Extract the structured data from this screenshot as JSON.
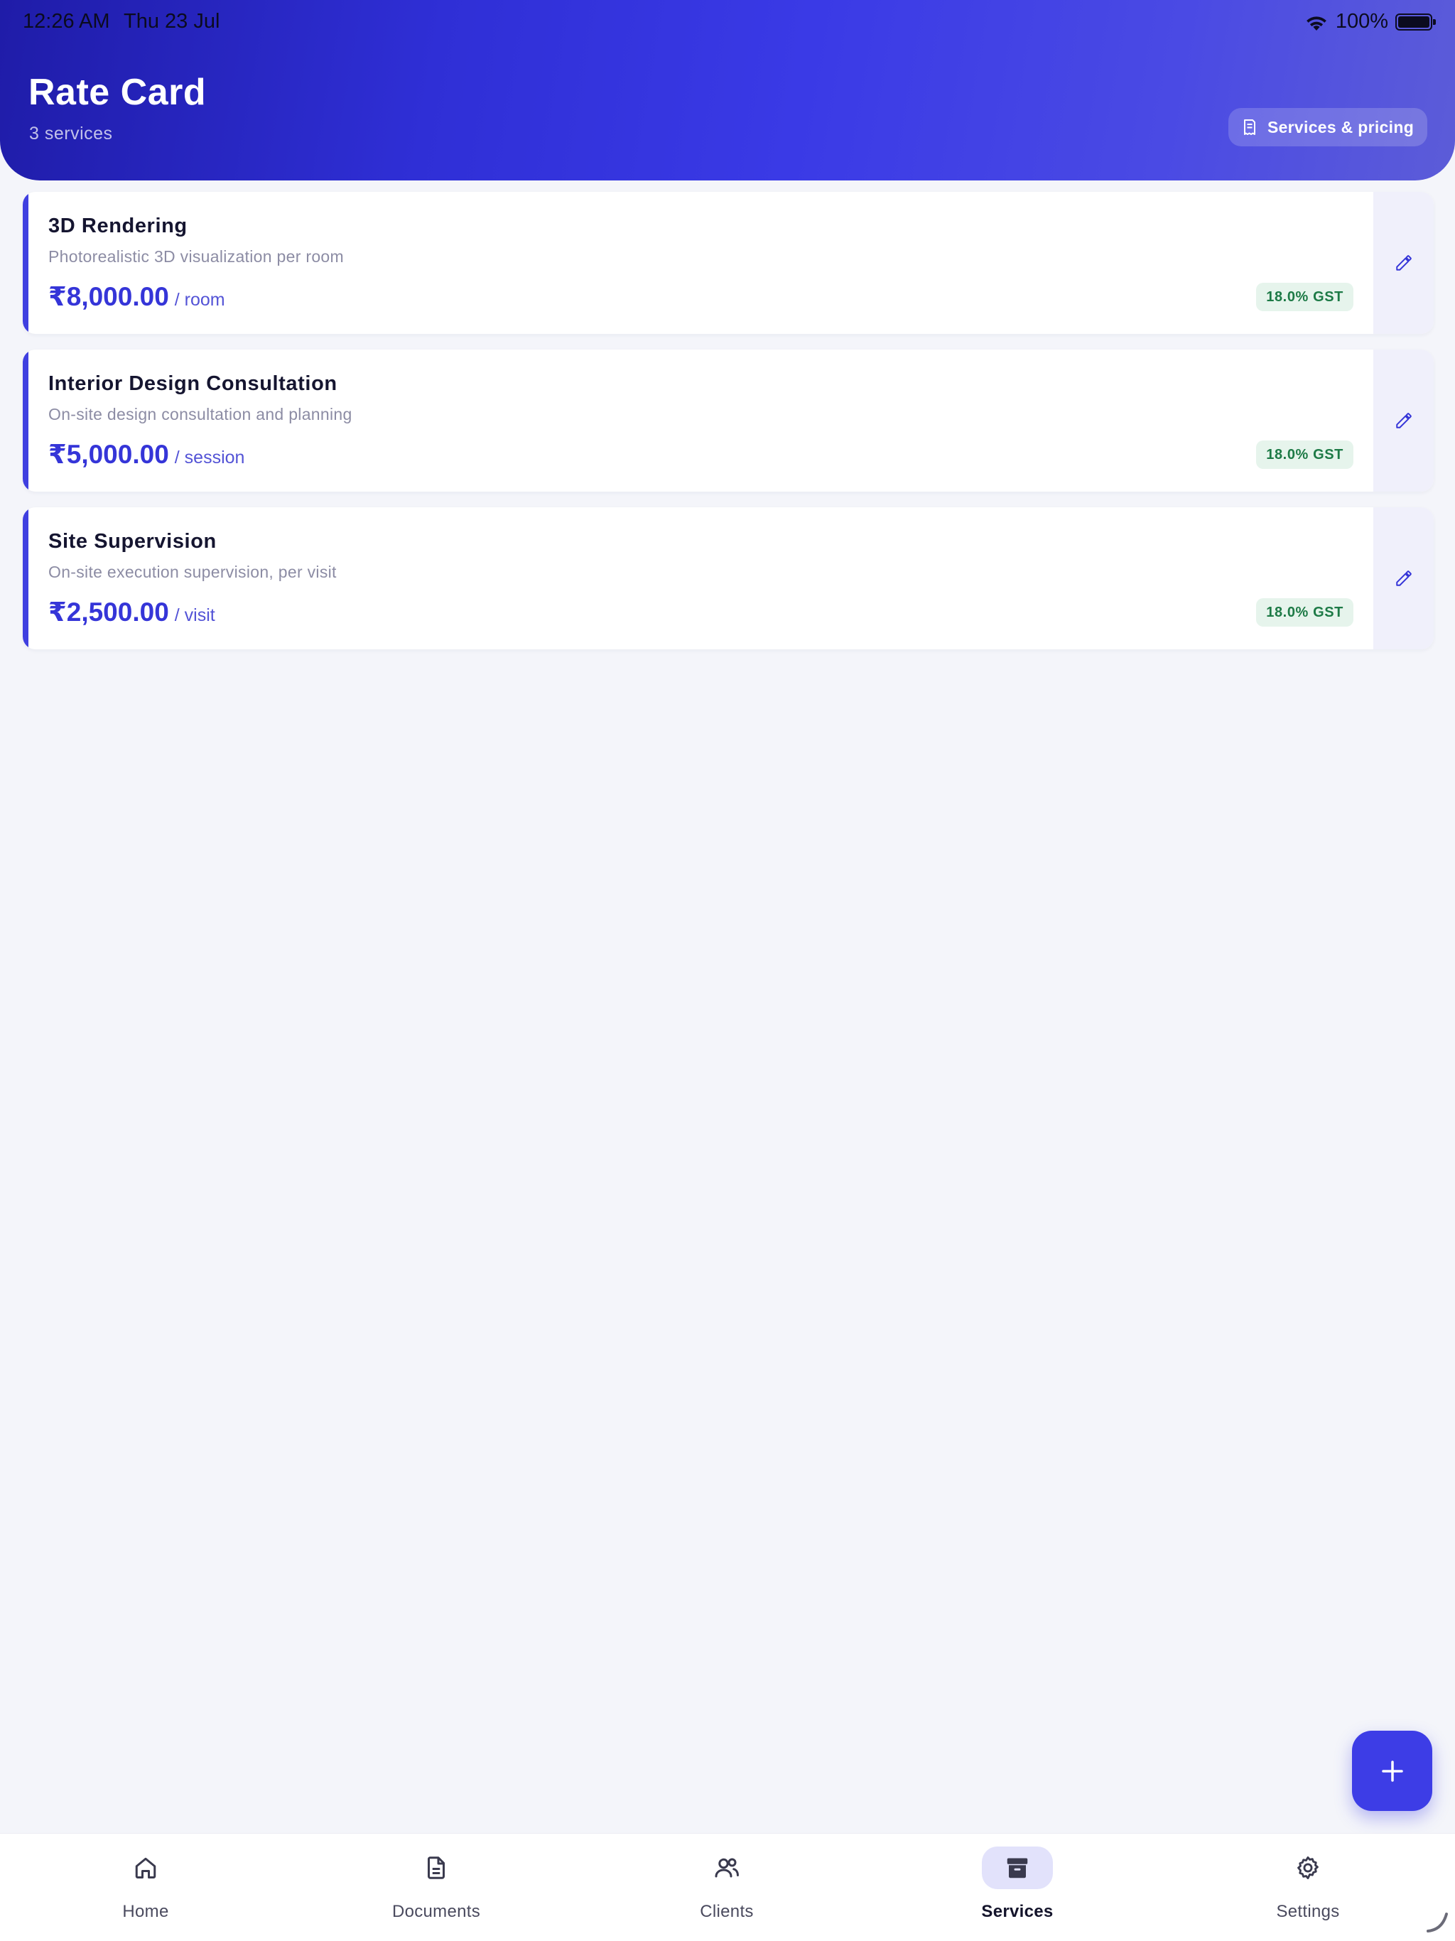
{
  "status": {
    "time": "12:26 AM",
    "date": "Thu 23 Jul",
    "battery": "100%"
  },
  "header": {
    "title": "Rate Card",
    "subtitle": "3 services",
    "pricing_button": "Services & pricing"
  },
  "services": [
    {
      "name": "3D Rendering",
      "description": "Photorealistic 3D visualization per room",
      "price": "₹8,000.00",
      "unit": "/ room",
      "gst": "18.0% GST"
    },
    {
      "name": "Interior Design Consultation",
      "description": "On-site design consultation and planning",
      "price": "₹5,000.00",
      "unit": "/ session",
      "gst": "18.0% GST"
    },
    {
      "name": "Site Supervision",
      "description": "On-site execution supervision, per visit",
      "price": "₹2,500.00",
      "unit": "/ visit",
      "gst": "18.0% GST"
    }
  ],
  "nav": {
    "items": [
      {
        "label": "Home",
        "icon": "home-icon"
      },
      {
        "label": "Documents",
        "icon": "document-icon"
      },
      {
        "label": "Clients",
        "icon": "people-icon"
      },
      {
        "label": "Services",
        "icon": "archive-box-icon",
        "active": true
      },
      {
        "label": "Settings",
        "icon": "gear-icon"
      }
    ]
  },
  "colors": {
    "accent": "#3d3de6",
    "gst_bg": "#e6f4ec",
    "gst_text": "#1d7a46"
  }
}
